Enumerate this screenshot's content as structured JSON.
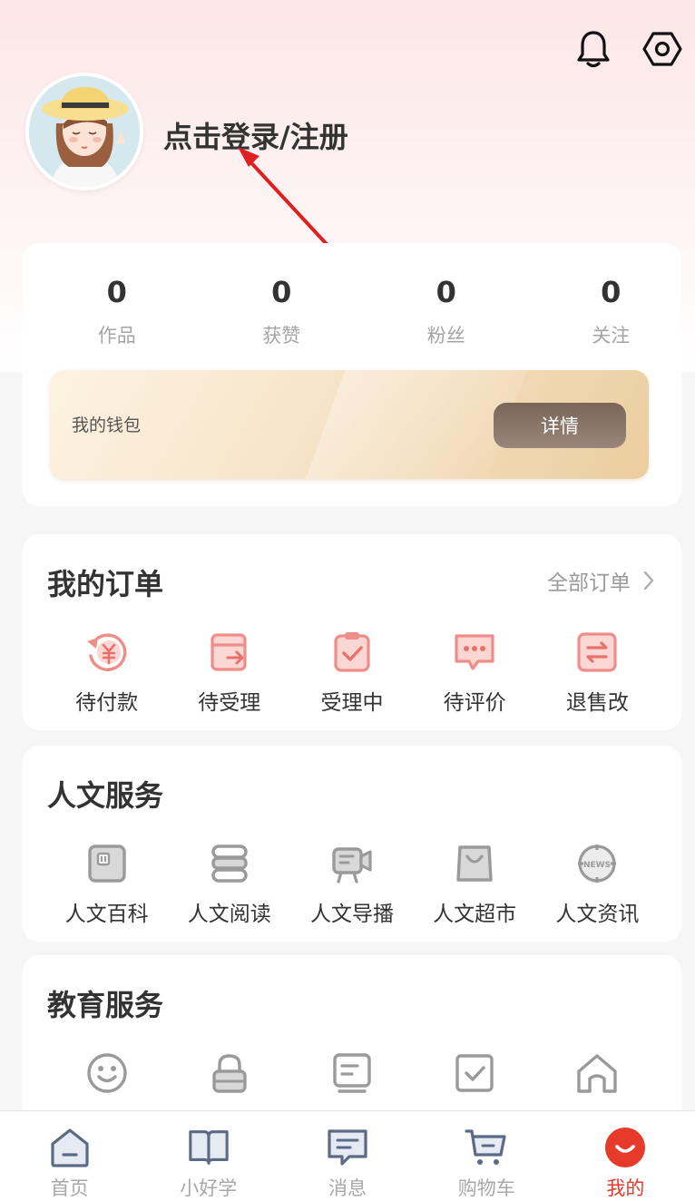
{
  "header": {
    "login_text": "点击登录/注册",
    "bell_icon": "bell-icon",
    "settings_icon": "settings-hex-icon"
  },
  "stats": [
    {
      "value": "0",
      "label": "作品"
    },
    {
      "value": "0",
      "label": "获赞"
    },
    {
      "value": "0",
      "label": "粉丝"
    },
    {
      "value": "0",
      "label": "关注"
    }
  ],
  "wallet": {
    "label": "我的钱包",
    "button": "详情"
  },
  "orders": {
    "title": "我的订单",
    "more": "全部订单",
    "items": [
      {
        "label": "待付款",
        "icon": "pending-payment-icon"
      },
      {
        "label": "待受理",
        "icon": "pending-accept-icon"
      },
      {
        "label": "受理中",
        "icon": "processing-icon"
      },
      {
        "label": "待评价",
        "icon": "pending-review-icon"
      },
      {
        "label": "退售改",
        "icon": "refund-icon"
      }
    ]
  },
  "humanities": {
    "title": "人文服务",
    "items": [
      {
        "label": "人文百科",
        "icon": "encyclopedia-icon"
      },
      {
        "label": "人文阅读",
        "icon": "reading-icon"
      },
      {
        "label": "人文导播",
        "icon": "broadcast-icon"
      },
      {
        "label": "人文超市",
        "icon": "shopping-bag-icon"
      },
      {
        "label": "人文资讯",
        "icon": "news-icon"
      }
    ]
  },
  "education": {
    "title": "教育服务",
    "items": [
      {
        "icon": "smiley-icon"
      },
      {
        "icon": "lock-icon"
      },
      {
        "icon": "document-icon"
      },
      {
        "icon": "checkbox-icon"
      },
      {
        "icon": "home-icon"
      }
    ]
  },
  "tabbar": {
    "items": [
      {
        "label": "首页",
        "icon": "home-tab-icon",
        "active": false
      },
      {
        "label": "小好学",
        "icon": "book-icon",
        "active": false
      },
      {
        "label": "消息",
        "icon": "message-icon",
        "active": false
      },
      {
        "label": "购物车",
        "icon": "cart-icon",
        "active": false
      },
      {
        "label": "我的",
        "icon": "profile-icon",
        "active": true
      }
    ]
  },
  "colors": {
    "accent": "#e63a2b",
    "order_icon": "#f08d88",
    "service_icon": "#9a9a9a"
  }
}
